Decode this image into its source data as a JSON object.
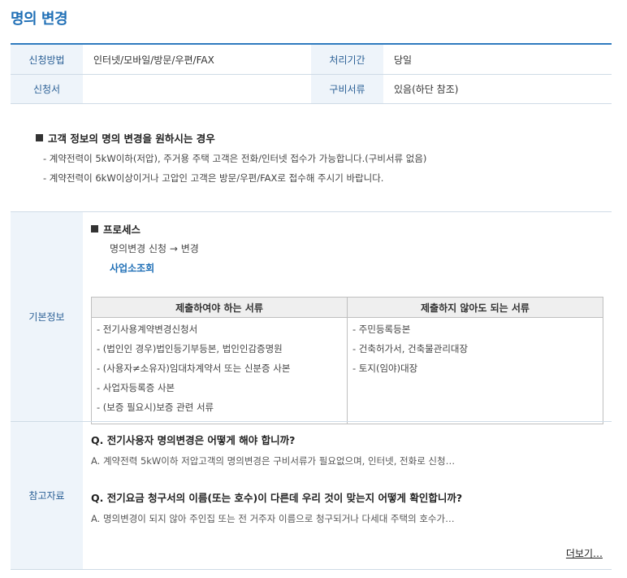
{
  "page": {
    "title": "명의 변경"
  },
  "info": {
    "method_label": "신청방법",
    "method_value": "인터넷/모바일/방문/우편/FAX",
    "period_label": "처리기간",
    "period_value": "당일",
    "form_label": "신청서",
    "form_value": "",
    "docs_label": "구비서류",
    "docs_value": "있음(하단 참조)"
  },
  "notice": {
    "title": "고객 정보의 명의 변경을 원하시는 경우",
    "lines": [
      "- 계약전력이 5kW이하(저압), 주거용 주택 고객은 전화/인터넷 접수가 가능합니다.(구비서류 없음)",
      "- 계약전력이 6kW이상이거나 고압인 고객은 방문/우편/FAX로 접수해 주시기 바랍니다."
    ]
  },
  "basic": {
    "label": "기본정보",
    "process_title": "프로세스",
    "process_flow": "명의변경 신청 → 변경",
    "process_link": "사업소조회",
    "table": {
      "headers": [
        "제출하여야 하는 서류",
        "제출하지 않아도 되는 서류"
      ],
      "required": [
        "- 전기사용계약변경신청서",
        "- (법인인 경우)법인등기부등본, 법인인감증명원",
        "- (사용자≠소유자)임대차계약서 또는 신분증 사본",
        "- 사업자등록증 사본",
        "- (보증 필요시)보증 관련 서류"
      ],
      "not_required": [
        "- 주민등록등본",
        "- 건축허가서, 건축물관리대장",
        "- 토지(임야)대장"
      ]
    }
  },
  "reference": {
    "label": "참고자료",
    "qa": [
      {
        "q": "Q. 전기사용자 명의변경은 어떻게 해야 합니까?",
        "a": "A. 계약전력 5kW이하 저압고객의 명의변경은 구비서류가 필요없으며, 인터넷, 전화로 신청…"
      },
      {
        "q": "Q. 전기요금 청구서의 이름(또는 호수)이 다른데 우리 것이 맞는지 어떻게 확인합니까?",
        "a": "A. 명의변경이 되지 않아 주인집 또는 전 거주자 이름으로 청구되거나 다세대 주택의 호수가…"
      }
    ],
    "more": "더보기…"
  }
}
